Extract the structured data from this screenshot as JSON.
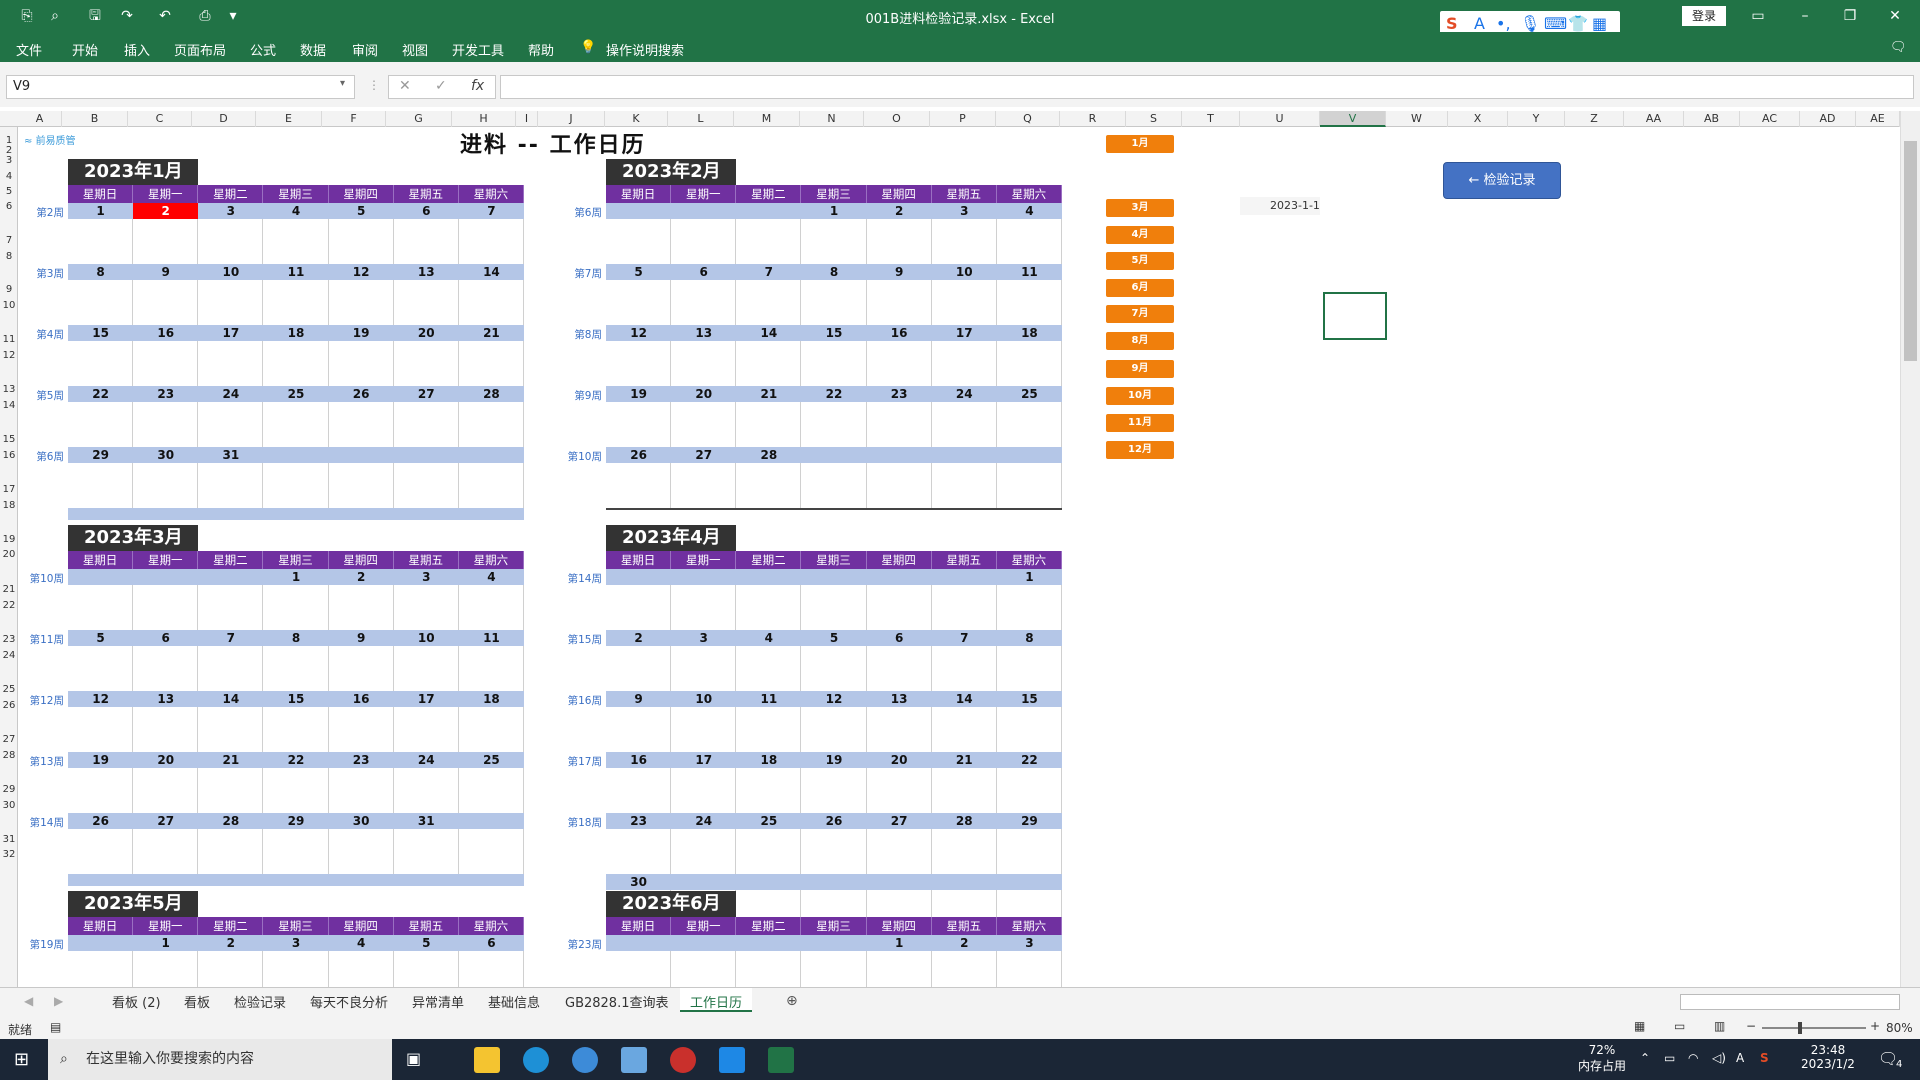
{
  "window": {
    "title": "001B进料检验记录.xlsx  -  Excel",
    "login_label": "登录"
  },
  "menu": [
    "文件",
    "开始",
    "插入",
    "页面布局",
    "公式",
    "数据",
    "审阅",
    "视图",
    "开发工具",
    "帮助",
    "操作说明搜索"
  ],
  "formula_bar": {
    "name_box": "V9",
    "fx_label": "fx",
    "formula_value": ""
  },
  "columns": [
    "A",
    "B",
    "C",
    "D",
    "E",
    "F",
    "G",
    "H",
    "I",
    "J",
    "K",
    "L",
    "M",
    "N",
    "O",
    "P",
    "Q",
    "R",
    "S",
    "T",
    "U",
    "V",
    "W",
    "X",
    "Y",
    "Z",
    "AA",
    "AB",
    "AC",
    "AD",
    "AE"
  ],
  "selected_column": "V",
  "rows": [
    "1",
    "2",
    "3",
    "4",
    "5",
    "6",
    "7",
    "8",
    "9",
    "10",
    "11",
    "12",
    "13",
    "14",
    "15",
    "16",
    "17",
    "18",
    "19",
    "20",
    "21",
    "22",
    "23",
    "24",
    "25",
    "26",
    "27",
    "28",
    "29",
    "30",
    "31",
    "32"
  ],
  "sheet": {
    "title": "进料 -- 工作日历",
    "logo_text": "前易质管",
    "weekdays": [
      "星期日",
      "星期一",
      "星期二",
      "星期三",
      "星期四",
      "星期五",
      "星期六"
    ],
    "months": [
      {
        "name": "2023年1月",
        "weeks": [
          {
            "label": "第2周",
            "days": [
              "1",
              "2",
              "3",
              "4",
              "5",
              "6",
              "7"
            ]
          },
          {
            "label": "第3周",
            "days": [
              "8",
              "9",
              "10",
              "11",
              "12",
              "13",
              "14"
            ]
          },
          {
            "label": "第4周",
            "days": [
              "15",
              "16",
              "17",
              "18",
              "19",
              "20",
              "21"
            ]
          },
          {
            "label": "第5周",
            "days": [
              "22",
              "23",
              "24",
              "25",
              "26",
              "27",
              "28"
            ]
          },
          {
            "label": "第6周",
            "days": [
              "29",
              "30",
              "31",
              "",
              "",
              "",
              ""
            ]
          }
        ]
      },
      {
        "name": "2023年2月",
        "weeks": [
          {
            "label": "第6周",
            "days": [
              "",
              "",
              "",
              "1",
              "2",
              "3",
              "4"
            ]
          },
          {
            "label": "第7周",
            "days": [
              "5",
              "6",
              "7",
              "8",
              "9",
              "10",
              "11"
            ]
          },
          {
            "label": "第8周",
            "days": [
              "12",
              "13",
              "14",
              "15",
              "16",
              "17",
              "18"
            ]
          },
          {
            "label": "第9周",
            "days": [
              "19",
              "20",
              "21",
              "22",
              "23",
              "24",
              "25"
            ]
          },
          {
            "label": "第10周",
            "days": [
              "26",
              "27",
              "28",
              "",
              "",
              "",
              ""
            ]
          }
        ]
      },
      {
        "name": "2023年3月",
        "weeks": [
          {
            "label": "第10周",
            "days": [
              "",
              "",
              "",
              "1",
              "2",
              "3",
              "4"
            ]
          },
          {
            "label": "第11周",
            "days": [
              "5",
              "6",
              "7",
              "8",
              "9",
              "10",
              "11"
            ]
          },
          {
            "label": "第12周",
            "days": [
              "12",
              "13",
              "14",
              "15",
              "16",
              "17",
              "18"
            ]
          },
          {
            "label": "第13周",
            "days": [
              "19",
              "20",
              "21",
              "22",
              "23",
              "24",
              "25"
            ]
          },
          {
            "label": "第14周",
            "days": [
              "26",
              "27",
              "28",
              "29",
              "30",
              "31",
              ""
            ]
          }
        ]
      },
      {
        "name": "2023年4月",
        "weeks": [
          {
            "label": "第14周",
            "days": [
              "",
              "",
              "",
              "",
              "",
              "",
              "1"
            ]
          },
          {
            "label": "第15周",
            "days": [
              "2",
              "3",
              "4",
              "5",
              "6",
              "7",
              "8"
            ]
          },
          {
            "label": "第16周",
            "days": [
              "9",
              "10",
              "11",
              "12",
              "13",
              "14",
              "15"
            ]
          },
          {
            "label": "第17周",
            "days": [
              "16",
              "17",
              "18",
              "19",
              "20",
              "21",
              "22"
            ]
          },
          {
            "label": "第18周",
            "days": [
              "23",
              "24",
              "25",
              "26",
              "27",
              "28",
              "29"
            ]
          },
          {
            "label": "",
            "days": [
              "30",
              "",
              "",
              "",
              "",
              "",
              ""
            ]
          }
        ]
      },
      {
        "name": "2023年5月",
        "weeks": [
          {
            "label": "第19周",
            "days": [
              "",
              "1",
              "2",
              "3",
              "4",
              "5",
              "6"
            ]
          }
        ]
      },
      {
        "name": "2023年6月",
        "weeks": [
          {
            "label": "第23周",
            "days": [
              "",
              "",
              "",
              "",
              "1",
              "2",
              "3"
            ]
          }
        ]
      }
    ],
    "today": "2",
    "month_buttons": [
      "1月",
      "3月",
      "4月",
      "5月",
      "6月",
      "7月",
      "8月",
      "9月",
      "10月",
      "11月",
      "12月"
    ],
    "date_cell": "2023-1-1",
    "link_button": "← 检验记录"
  },
  "tabs": [
    "看板 (2)",
    "看板",
    "检验记录",
    "每天不良分析",
    "异常清单",
    "基础信息",
    "GB2828.1查询表",
    "工作日历"
  ],
  "active_tab": "工作日历",
  "status": {
    "ready": "就绪",
    "zoom": "80%"
  },
  "taskbar": {
    "search_placeholder": "在这里输入你要搜索的内容",
    "memory": "72%",
    "memory_label": "内存占用",
    "time": "23:48",
    "date": "2023/1/2",
    "notifications": "4"
  },
  "colors": {
    "excel_green": "#217346",
    "weekday_purple": "#7030a0",
    "week_band": "#b4c6e7",
    "month_button": "#f07f0c",
    "today_red": "#ff0000",
    "link_blue": "#4472c4"
  }
}
